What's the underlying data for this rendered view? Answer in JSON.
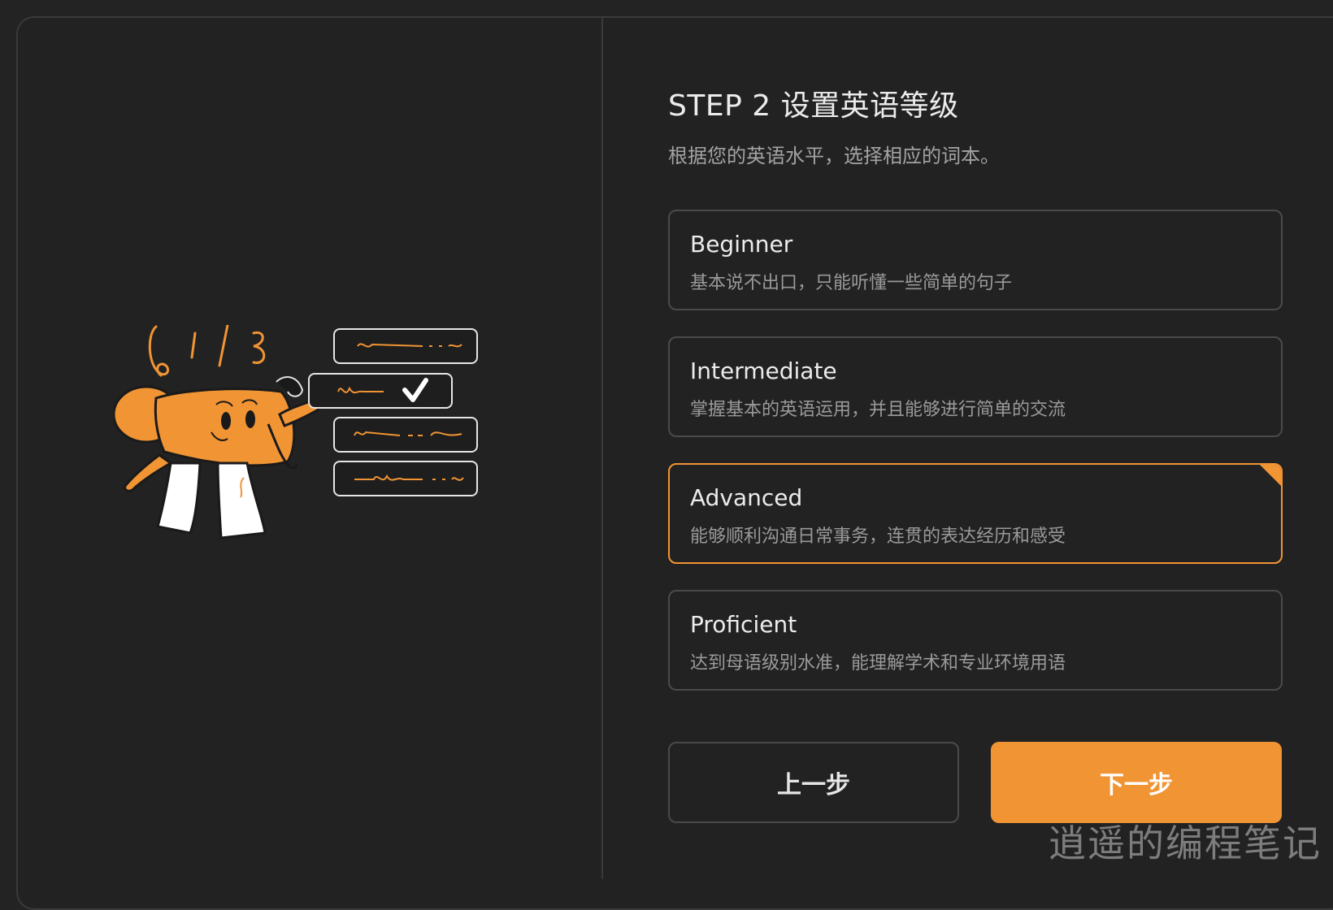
{
  "header": {
    "title": "STEP 2 设置英语等级",
    "subtitle": "根据您的英语水平，选择相应的词本。"
  },
  "options": [
    {
      "title": "Beginner",
      "desc": "基本说不出口，只能听懂一些简单的句子",
      "selected": false
    },
    {
      "title": "Intermediate",
      "desc": "掌握基本的英语运用，并且能够进行简单的交流",
      "selected": false
    },
    {
      "title": "Advanced",
      "desc": "能够顺利沟通日常事务，连贯的表达经历和感受",
      "selected": true
    },
    {
      "title": "Proficient",
      "desc": "达到母语级别水准，能理解学术和专业环境用语",
      "selected": false
    }
  ],
  "buttons": {
    "prev": "上一步",
    "next": "下一步"
  },
  "watermark": "逍遥的编程笔记",
  "illustration": {
    "icon": "elephant-checklist-illustration",
    "checkmark_icon": "check-icon"
  },
  "colors": {
    "accent": "#f19434",
    "background": "#222222",
    "border": "#4a4a4a",
    "text": "#ececec",
    "muted": "#9a9a9a"
  }
}
